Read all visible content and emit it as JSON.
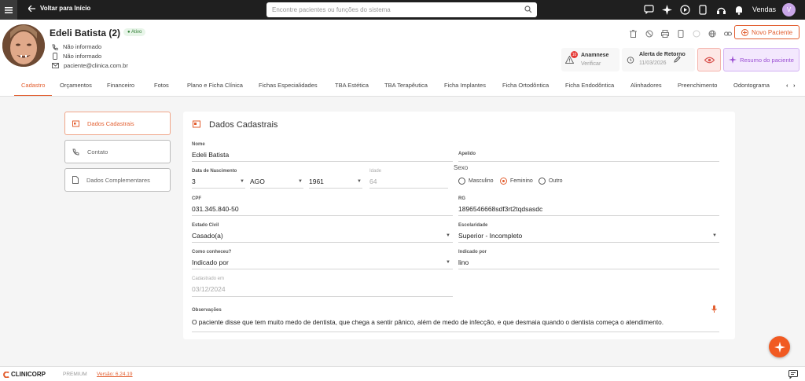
{
  "topbar": {
    "back_label": "Voltar para Início",
    "search_placeholder": "Encontre pacientes ou funções do sistema",
    "user_label": "Vendas",
    "user_initial": "V"
  },
  "patient": {
    "name": "Edeli Batista (2)",
    "status": "Ativo",
    "phone": "Não informado",
    "mobile": "Não informado",
    "email": "paciente@clinica.com.br"
  },
  "header_actions": {
    "new_patient_label": "Novo Paciente"
  },
  "cards": {
    "anamnese_title": "Anamnese",
    "anamnese_sub": "Verificar",
    "anamnese_count": "10",
    "retorno_title": "Alerta de Retorno",
    "retorno_date": "11/03/2026",
    "resumo_label": "Resumo do paciente"
  },
  "tabs": [
    "Cadastro",
    "Orçamentos",
    "Financeiro",
    "Fotos",
    "Plano e Ficha Clínica",
    "Fichas Especialidades",
    "TBA Estética",
    "TBA Terapêutica",
    "Ficha Implantes",
    "Ficha Ortodôntica",
    "Ficha Endodôntica",
    "Alinhadores",
    "Preenchimento",
    "Odontograma"
  ],
  "sidebar": [
    "Dados Cadastrais",
    "Contato",
    "Dados Complementares"
  ],
  "form": {
    "title": "Dados Cadastrais",
    "nome_label": "Nome",
    "nome": "Edeli Batista",
    "apelido_label": "Apelido",
    "apelido": "",
    "nasc_label": "Data de Nascimento",
    "dia": "3",
    "mes": "AGO",
    "ano": "1961",
    "idade_label": "Idade",
    "idade": "64",
    "sexo_label": "Sexo",
    "sexo_options": [
      "Masculino",
      "Feminino",
      "Outro"
    ],
    "cpf_label": "CPF",
    "cpf": "031.345.840-50",
    "rg_label": "RG",
    "rg": "1896546668sdf3rt2tqdsasdc",
    "estado_civil_label": "Estado Civil",
    "estado_civil": "Casado(a)",
    "escolaridade_label": "Escolaridade",
    "escolaridade": "Superior - Incompleto",
    "como_label": "Como conheceu?",
    "como": "Indicado por",
    "indicado_label": "Indicado por",
    "indicado": "lino",
    "cadastrado_label": "Cadastrado em",
    "cadastrado": "03/12/2024",
    "obs_label": "Observações",
    "obs": "O paciente disse que tem muito medo de dentista, que chega a sentir pânico, além de medo de infecção, e que desmaia quando o dentista começa o atendimento."
  },
  "footer": {
    "logo": "CLINICORP",
    "plan": "PREMIUM",
    "version": "Versão: 6.24.19"
  },
  "colors": {
    "accent": "#e25d2e",
    "purple": "#9b4fd3",
    "topbar": "#1f1f1f"
  }
}
